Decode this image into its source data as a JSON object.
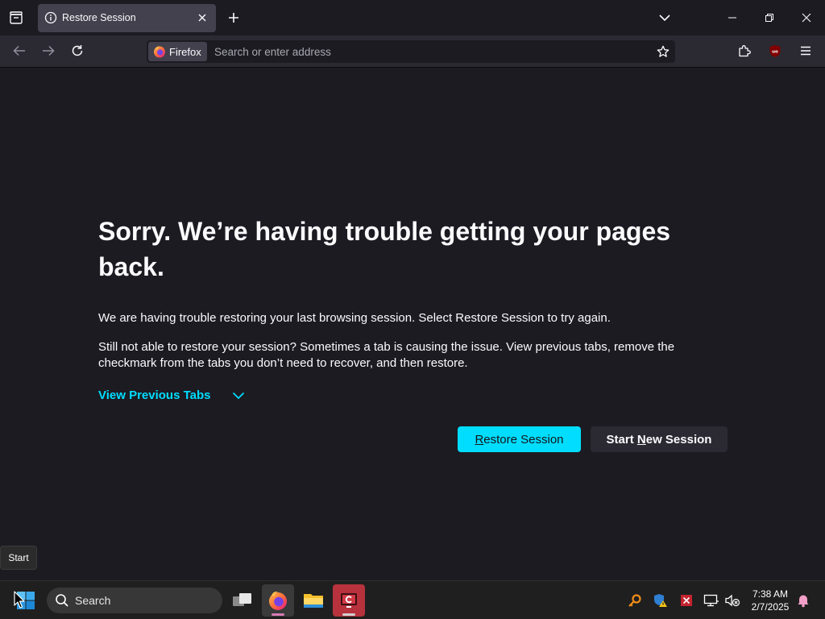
{
  "tab": {
    "title": "Restore Session"
  },
  "urlbar": {
    "identity_label": "Firefox",
    "placeholder": "Search or enter address"
  },
  "content": {
    "heading": "Sorry. We’re having trouble getting your pages back.",
    "para1": "We are having trouble restoring your last browsing session. Select Restore Session to try again.",
    "para2": "Still not able to restore your session? Sometimes a tab is causing the issue. View previous tabs, remove the checkmark from the tabs you don’t need to recover, and then restore.",
    "view_previous": "View Previous Tabs",
    "restore_button": {
      "first": "R",
      "rest": "estore Session"
    },
    "new_session_button": {
      "before": "Start ",
      "accel": "N",
      "after": "ew Session"
    }
  },
  "tooltip": {
    "text": "Start"
  },
  "taskbar": {
    "search_label": "Search",
    "clock": {
      "time": "7:38 AM",
      "date": "2/7/2025"
    }
  },
  "colors": {
    "accent": "#00ddff",
    "background": "#1c1b22",
    "toolbar": "#2b2a33"
  },
  "icons": {
    "tabstrip": [
      "list-all-tabs-icon",
      "info-icon",
      "close-icon",
      "plus-icon",
      "chevron-down-icon",
      "minimize-icon",
      "restore-icon",
      "close-window-icon"
    ],
    "navbar": [
      "back-arrow-icon",
      "forward-arrow-icon",
      "reload-icon",
      "firefox-logo-icon",
      "star-icon",
      "extensions-icon",
      "ublock-origin-icon",
      "hamburger-menu-icon"
    ],
    "taskbar": [
      "windows-start-icon",
      "search-icon",
      "task-view-icon",
      "firefox-app-icon",
      "file-explorer-icon",
      "red-app-icon",
      "key-icon",
      "shield-warning-icon",
      "red-x-icon",
      "network-icon",
      "muted-volume-icon",
      "bell-icon"
    ]
  }
}
